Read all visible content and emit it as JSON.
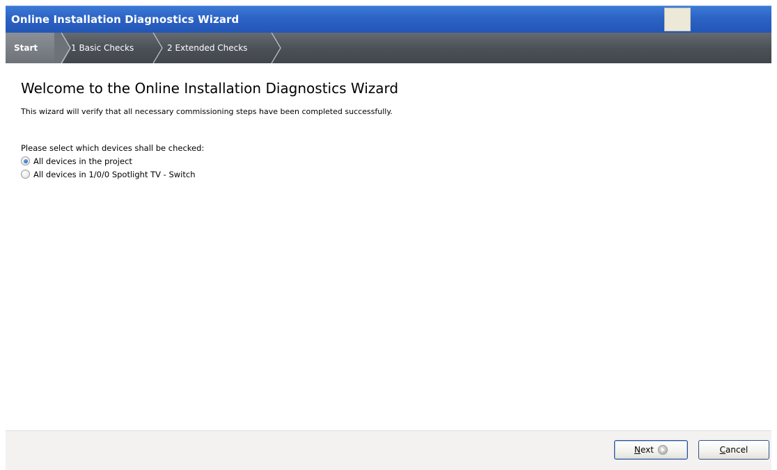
{
  "window": {
    "title": "Online Installation Diagnostics Wizard"
  },
  "steps": [
    {
      "label": "Start",
      "active": true
    },
    {
      "label": "1 Basic Checks",
      "active": false
    },
    {
      "label": "2 Extended Checks",
      "active": false
    }
  ],
  "main": {
    "heading": "Welcome to the Online Installation Diagnostics Wizard",
    "description": "This wizard will verify that all necessary commissioning steps have been completed successfully.",
    "prompt": "Please select which devices shall be checked:",
    "options": [
      {
        "label": "All devices in the project",
        "selected": true
      },
      {
        "label": "All devices in 1/0/0 Spotlight TV - Switch",
        "selected": false
      }
    ]
  },
  "footer": {
    "next_label_mnemonic": "N",
    "next_label_rest": "ext",
    "cancel_label_mnemonic": "C",
    "cancel_label_rest": "ancel",
    "next_icon": "forward-arrow-icon"
  },
  "colors": {
    "titlebar": "#2c63c4",
    "stepbar": "#4b5157",
    "active_step": "#7a8086",
    "footer": "#f3f2f1"
  }
}
